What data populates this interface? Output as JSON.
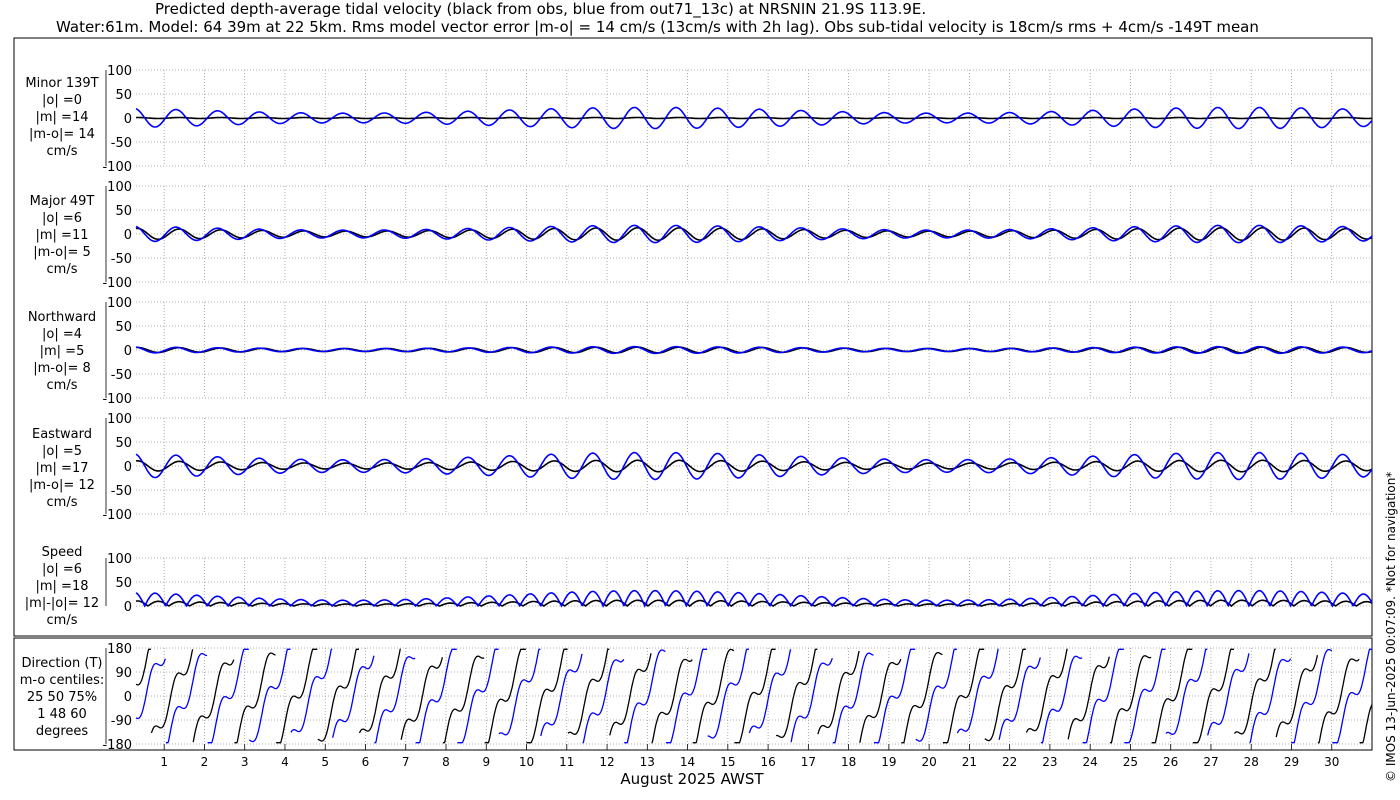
{
  "title_line1": "Predicted depth-average tidal velocity (black from obs, blue from out71_13c) at NRSNIN 21.9S 113.9E.",
  "title_line2": "Water:61m. Model: 64 39m at 22 5km. Rms model vector error |m-o| = 14 cm/s (13cm/s with 2h lag). Obs sub-tidal velocity is 18cm/s rms + 4cm/s -149T mean",
  "copyright": "© IMOS 13-Jun-2025 00:07:09. *Not for navigation*",
  "xlabel": "August 2025 AWST",
  "colors": {
    "obs": "#000000",
    "model": "#0000ff",
    "grid": "#999999"
  },
  "chart_data": [
    {
      "type": "line",
      "panel": "minor",
      "label_lines": [
        "Minor 139T",
        "|o| =0",
        "|m| =14",
        "|m-o|= 14",
        "cm/s"
      ],
      "ylim": [
        -100,
        100
      ],
      "yticks": [
        -100,
        -50,
        0,
        50,
        100
      ],
      "xlim": [
        0.3,
        31.0
      ],
      "grid": true,
      "series": [
        {
          "key": "obs",
          "amplitude": [
            1,
            1
          ],
          "offset": 0
        },
        {
          "key": "model",
          "amplitude": [
            10,
            22
          ],
          "offset": 0
        }
      ]
    },
    {
      "type": "line",
      "panel": "major",
      "label_lines": [
        "Major 49T",
        "|o| =6",
        "|m| =11",
        "|m-o|= 5",
        "cm/s"
      ],
      "ylim": [
        -100,
        100
      ],
      "yticks": [
        -100,
        -50,
        0,
        50,
        100
      ],
      "xlim": [
        0.3,
        31.0
      ],
      "grid": true,
      "series": [
        {
          "key": "obs",
          "amplitude": [
            6,
            13
          ],
          "offset": 0
        },
        {
          "key": "model",
          "amplitude": [
            8,
            18
          ],
          "offset": 0
        }
      ]
    },
    {
      "type": "line",
      "panel": "northward",
      "label_lines": [
        "Northward",
        "|o| =4",
        "|m| =5",
        "|m-o|= 8",
        "cm/s"
      ],
      "ylim": [
        -100,
        100
      ],
      "yticks": [
        -100,
        -50,
        0,
        50,
        100
      ],
      "xlim": [
        0.3,
        31.0
      ],
      "grid": true,
      "series": [
        {
          "key": "obs",
          "amplitude": [
            3,
            6
          ],
          "offset": 0
        },
        {
          "key": "model",
          "amplitude": [
            3,
            7
          ],
          "offset": 0
        }
      ]
    },
    {
      "type": "line",
      "panel": "eastward",
      "label_lines": [
        "Eastward",
        "|o| =5",
        "|m| =17",
        "|m-o|= 12",
        "cm/s"
      ],
      "ylim": [
        -100,
        100
      ],
      "yticks": [
        -100,
        -50,
        0,
        50,
        100
      ],
      "xlim": [
        0.3,
        31.0
      ],
      "grid": true,
      "series": [
        {
          "key": "obs",
          "amplitude": [
            6,
            12
          ],
          "offset": 0
        },
        {
          "key": "model",
          "amplitude": [
            13,
            28
          ],
          "offset": 0
        }
      ]
    },
    {
      "type": "line",
      "panel": "speed",
      "label_lines": [
        "Speed",
        "|o| =6",
        "|m| =18",
        "|m|-|o|= 12",
        "cm/s"
      ],
      "ylim": [
        0,
        100
      ],
      "yticks": [
        0,
        50,
        100
      ],
      "xlim": [
        0.3,
        31.0
      ],
      "grid": true,
      "series": [
        {
          "key": "obs",
          "amplitude": [
            4,
            12
          ],
          "offset": 0
        },
        {
          "key": "model",
          "amplitude": [
            12,
            32
          ],
          "offset": 0
        }
      ]
    },
    {
      "type": "line",
      "panel": "direction",
      "label_lines": [
        "Direction (T)",
        "m-o centiles:",
        "25  50  75%",
        "1  48  60",
        "degrees"
      ],
      "ylim": [
        -180,
        180
      ],
      "yticks": [
        -180,
        -90,
        0,
        90,
        180
      ],
      "xlim": [
        0.3,
        31.0
      ],
      "grid": true,
      "series": [
        {
          "key": "obs",
          "wrapped": true
        },
        {
          "key": "model",
          "wrapped": true
        }
      ]
    }
  ],
  "xaxis": {
    "tick_labels": [
      "1",
      "2",
      "3",
      "4",
      "5",
      "6",
      "7",
      "8",
      "9",
      "10",
      "11",
      "12",
      "13",
      "14",
      "15",
      "16",
      "17",
      "18",
      "19",
      "20",
      "21",
      "22",
      "23",
      "24",
      "25",
      "26",
      "27",
      "28",
      "29",
      "30"
    ]
  }
}
